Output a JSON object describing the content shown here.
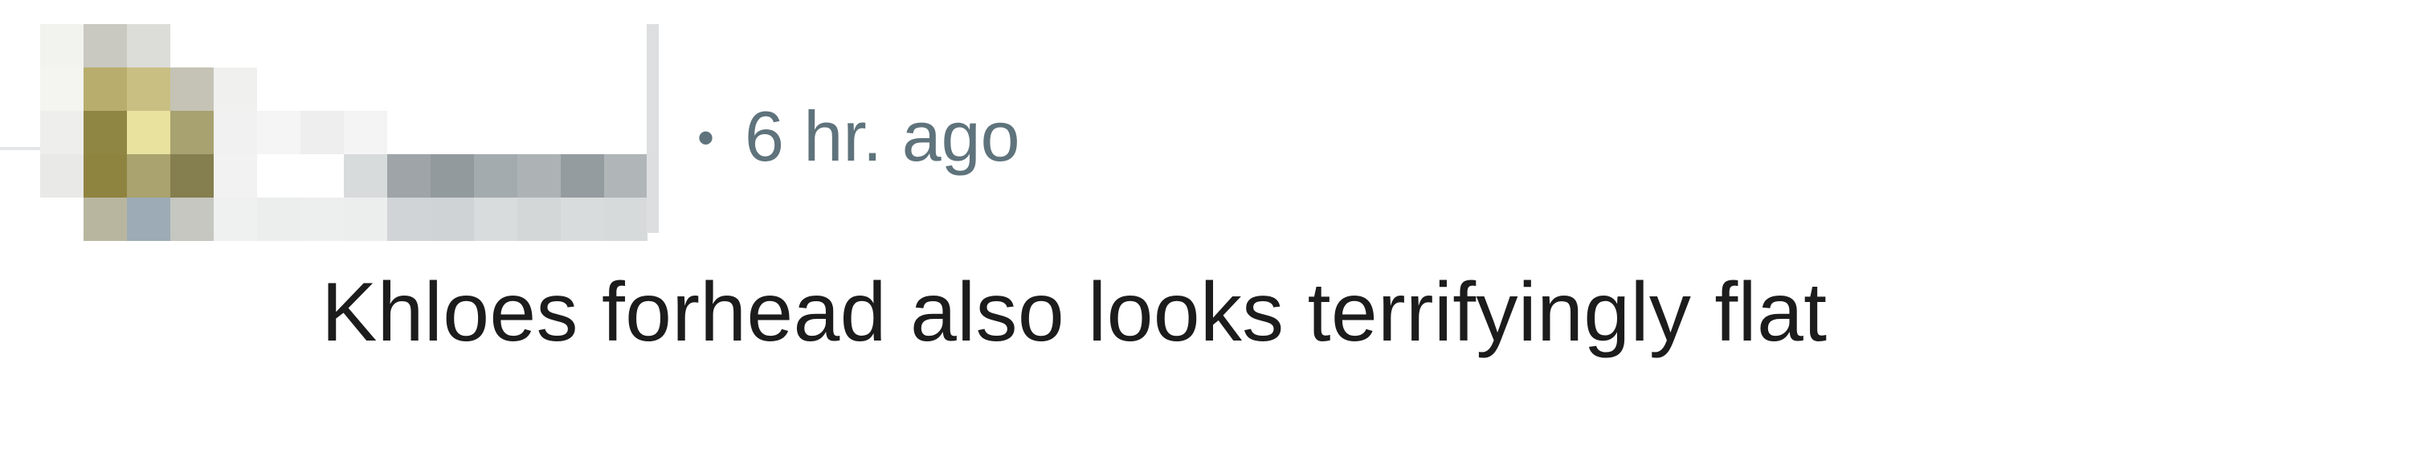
{
  "comment": {
    "timestamp": "6 hr. ago",
    "separator": "•",
    "body": "Khloes forhead also looks terrifyingly flat"
  },
  "icons": {
    "avatar": "pixelated-avatar",
    "username": "pixelated-username"
  },
  "colors": {
    "background": "#ffffff",
    "meta_text": "#5f737c",
    "body_text": "#1c1c1c",
    "thread_line": "#e4e6e8"
  }
}
